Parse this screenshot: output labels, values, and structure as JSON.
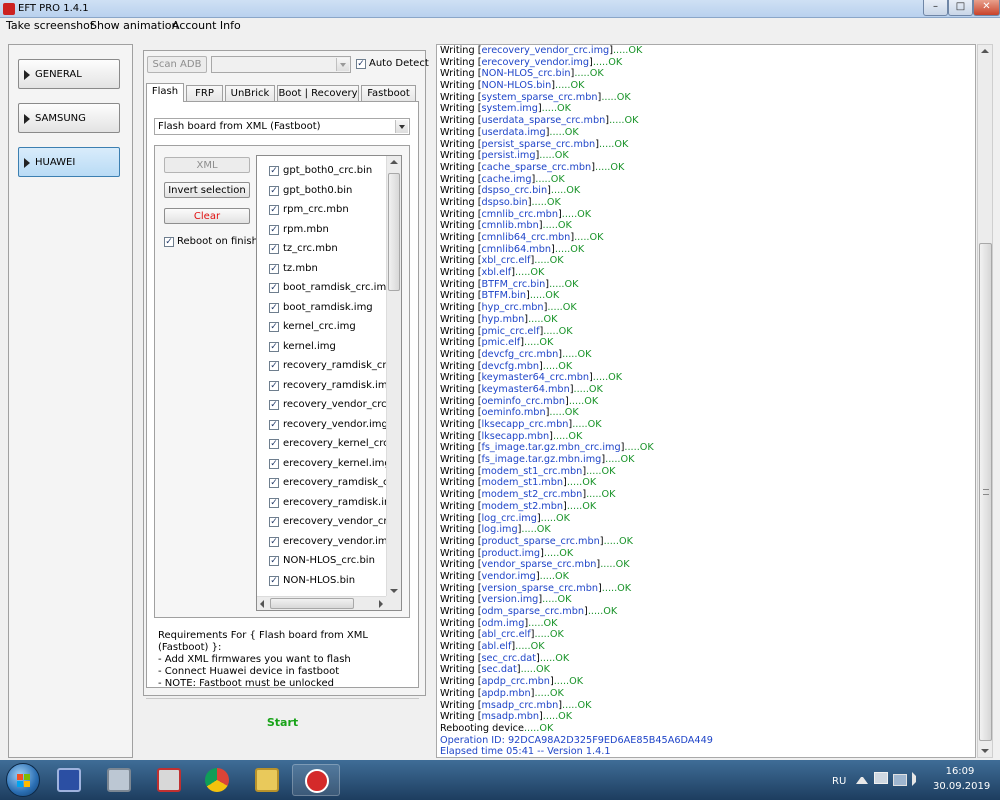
{
  "window": {
    "title": "EFT PRO 1.4.1",
    "min": "–",
    "max": "□",
    "close": "✕"
  },
  "menu": [
    "Take screenshot",
    "Show animation",
    "Account Info"
  ],
  "nav": [
    {
      "label": "GENERAL",
      "active": false
    },
    {
      "label": "SAMSUNG",
      "active": false
    },
    {
      "label": "HUAWEI",
      "active": true
    }
  ],
  "adb": {
    "scan_label": "Scan ADB",
    "device_value": "",
    "auto_detect_label": "Auto Detect",
    "auto_detect_checked": "✓"
  },
  "tabs": [
    "Flash",
    "FRP",
    "UnBrick",
    "Boot | Recovery",
    "Fastboot"
  ],
  "flash": {
    "mode_value": "Flash board from XML (Fastboot)",
    "xml_label": "XML",
    "invert_label": "Invert selection",
    "clear_label": "Clear",
    "reboot_label": "Reboot on finish",
    "reboot_checked": "✓",
    "files": [
      "gpt_both0_crc.bin",
      "gpt_both0.bin",
      "rpm_crc.mbn",
      "rpm.mbn",
      "tz_crc.mbn",
      "tz.mbn",
      "boot_ramdisk_crc.img",
      "boot_ramdisk.img",
      "kernel_crc.img",
      "kernel.img",
      "recovery_ramdisk_crc.img",
      "recovery_ramdisk.img",
      "recovery_vendor_crc.img",
      "recovery_vendor.img",
      "erecovery_kernel_crc.img",
      "erecovery_kernel.img",
      "erecovery_ramdisk_crc.img",
      "erecovery_ramdisk.img",
      "erecovery_vendor_crc.img",
      "erecovery_vendor.img",
      "NON-HLOS_crc.bin",
      "NON-HLOS.bin"
    ],
    "check_glyph": "✓",
    "requirements": [
      "Requirements For { Flash board from XML (Fastboot) }:",
      " - Add XML firmwares you want to flash",
      " - Connect Huawei device in fastboot",
      " - NOTE: Fastboot must be unlocked"
    ],
    "start_label": "Start"
  },
  "log": {
    "prefix": "Writing",
    "ok": ".....OK",
    "files": [
      "erecovery_vendor_crc.img",
      "erecovery_vendor.img",
      "NON-HLOS_crc.bin",
      "NON-HLOS.bin",
      "system_sparse_crc.mbn",
      "system.img",
      "userdata_sparse_crc.mbn",
      "userdata.img",
      "persist_sparse_crc.mbn",
      "persist.img",
      "cache_sparse_crc.mbn",
      "cache.img",
      "dspso_crc.bin",
      "dspso.bin",
      "cmnlib_crc.mbn",
      "cmnlib.mbn",
      "cmnlib64_crc.mbn",
      "cmnlib64.mbn",
      "xbl_crc.elf",
      "xbl.elf",
      "BTFM_crc.bin",
      "BTFM.bin",
      "hyp_crc.mbn",
      "hyp.mbn",
      "pmic_crc.elf",
      "pmic.elf",
      "devcfg_crc.mbn",
      "devcfg.mbn",
      "keymaster64_crc.mbn",
      "keymaster64.mbn",
      "oeminfo_crc.mbn",
      "oeminfo.mbn",
      "lksecapp_crc.mbn",
      "lksecapp.mbn",
      "fs_image.tar.gz.mbn_crc.img",
      "fs_image.tar.gz.mbn.img",
      "modem_st1_crc.mbn",
      "modem_st1.mbn",
      "modem_st2_crc.mbn",
      "modem_st2.mbn",
      "log_crc.img",
      "log.img",
      "product_sparse_crc.mbn",
      "product.img",
      "vendor_sparse_crc.mbn",
      "vendor.img",
      "version_sparse_crc.mbn",
      "version.img",
      "odm_sparse_crc.mbn",
      "odm.img",
      "abl_crc.elf",
      "abl.elf",
      "sec_crc.dat",
      "sec.dat",
      "apdp_crc.mbn",
      "apdp.mbn",
      "msadp_crc.mbn",
      "msadp.mbn"
    ],
    "rebooting": "Rebooting device",
    "operation_id": "Operation ID: 92DCA98A2D325F9ED6AE85B45A6DA449",
    "elapsed": "Elapsed time 05:41 -- Version 1.4.1"
  },
  "taskbar": {
    "lang": "RU",
    "time": "16:09",
    "date": "30.09.2019"
  },
  "colors": {
    "ok": "#179227",
    "file": "#1f45c8",
    "clear": "#e01010",
    "start": "#19a319"
  }
}
